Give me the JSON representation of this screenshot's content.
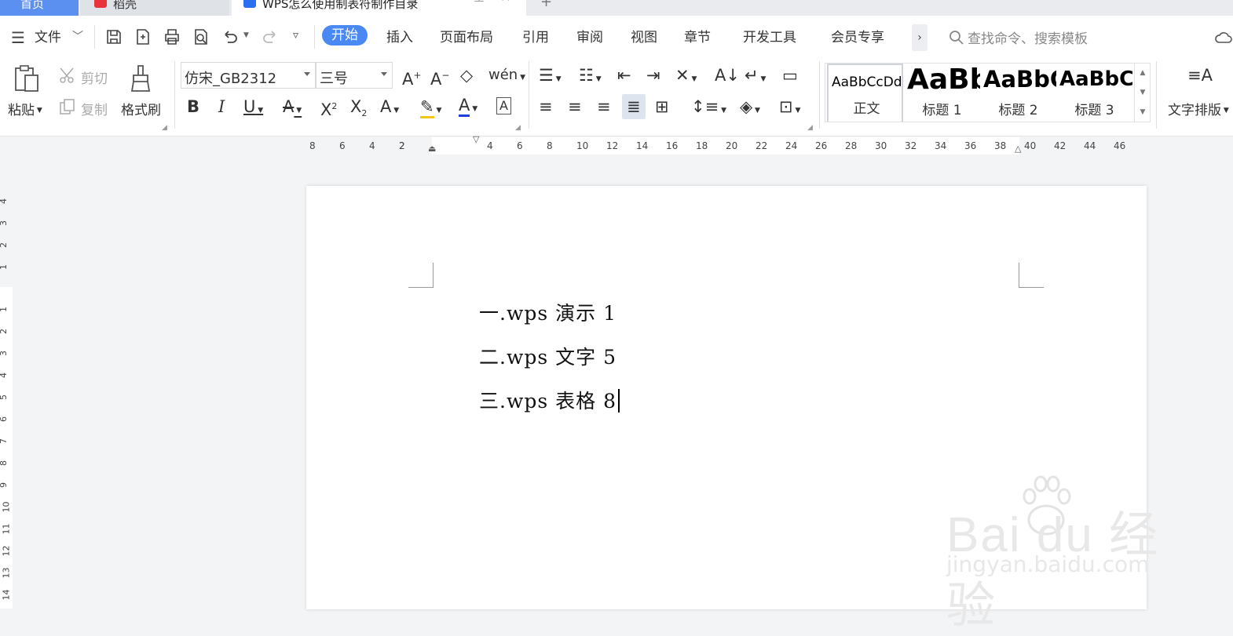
{
  "tabs": {
    "home": "首页",
    "daoke": "稻壳",
    "doc": "WPS怎么使用制表符制作目录"
  },
  "menu": {
    "file": "文件",
    "start": "开始",
    "insert": "插入",
    "layout": "页面布局",
    "ref": "引用",
    "review": "审阅",
    "view": "视图",
    "chapter": "章节",
    "dev": "开发工具",
    "vip": "会员专享",
    "search_placeholder": "查找命令、搜索模板"
  },
  "ribbon": {
    "paste": "粘贴",
    "cut": "剪切",
    "copy": "复制",
    "format_painter": "格式刷",
    "font_name": "仿宋_GB2312",
    "font_size": "三号",
    "text_layout": "文字排版",
    "styles": [
      {
        "preview": "AaBbCcDd",
        "name": "正文"
      },
      {
        "preview": "AaBb",
        "name": "标题 1"
      },
      {
        "preview": "AaBbC",
        "name": "标题 2"
      },
      {
        "preview": "AaBbCc",
        "name": "标题 3"
      }
    ]
  },
  "ruler": {
    "h": [
      "8",
      "6",
      "4",
      "2",
      "2",
      "4",
      "6",
      "8",
      "10",
      "12",
      "14",
      "16",
      "18",
      "20",
      "22",
      "24",
      "26",
      "28",
      "30",
      "32",
      "34",
      "36",
      "38",
      "40",
      "42",
      "44",
      "46"
    ],
    "v": [
      "4",
      "3",
      "2",
      "1",
      "1",
      "2",
      "3",
      "4",
      "5",
      "6",
      "7",
      "8",
      "9",
      "10",
      "11",
      "12",
      "13",
      "14"
    ]
  },
  "document": {
    "lines": [
      "一.wps 演示 1",
      "二.wps 文字 5",
      "三.wps 表格 8"
    ]
  },
  "watermark": {
    "brand": "Bai du 经验",
    "url": "jingyan.baidu.com"
  },
  "colors": {
    "accent": "#4a89f3",
    "highlight": "#f5c518",
    "font_color": "#1f3fdc"
  }
}
